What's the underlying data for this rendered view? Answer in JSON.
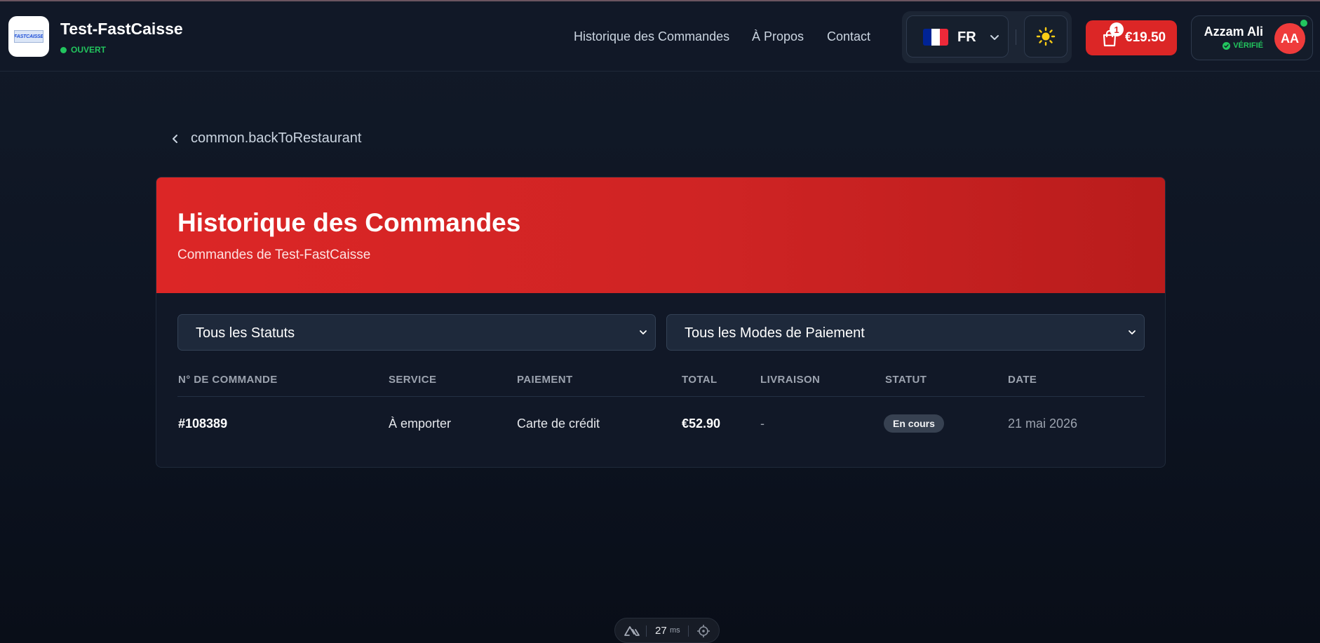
{
  "brand": {
    "name": "Test-FastCaisse",
    "logo_text": "FASTCAISSE",
    "status": "OUVERT"
  },
  "nav": {
    "items": [
      "Historique des Commandes",
      "À Propos",
      "Contact"
    ]
  },
  "language": {
    "code": "FR",
    "flag_colors": [
      "#002395",
      "#ffffff",
      "#ed2939"
    ]
  },
  "theme": {
    "icon": "sun-icon"
  },
  "cart": {
    "count": "1",
    "total": "€19.50"
  },
  "user": {
    "name": "Azzam Ali",
    "verified_label": "VÉRIFIÉ",
    "initials": "AA"
  },
  "back_link": {
    "label": "common.backToRestaurant"
  },
  "orders": {
    "title": "Historique des Commandes",
    "subtitle": "Commandes de Test-FastCaisse",
    "filters": {
      "status": "Tous les Statuts",
      "payment": "Tous les Modes de Paiement"
    },
    "columns": [
      "N° DE COMMANDE",
      "SERVICE",
      "PAIEMENT",
      "TOTAL",
      "LIVRAISON",
      "STATUT",
      "DATE"
    ],
    "rows": [
      {
        "id": "#108389",
        "service": "À emporter",
        "payment": "Carte de crédit",
        "total": "€52.90",
        "delivery": "-",
        "status": "En cours",
        "date": "21 mai 2026"
      }
    ]
  },
  "devtools": {
    "ms_value": "27",
    "ms_unit": "ms"
  },
  "colors": {
    "accent": "#dc2626",
    "success": "#22c55e",
    "background": "#0d1422"
  }
}
